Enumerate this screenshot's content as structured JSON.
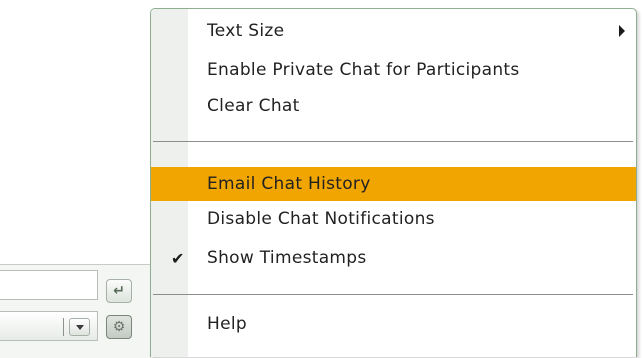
{
  "menu": {
    "items": [
      {
        "label": "Text Size",
        "has_submenu": true,
        "checked": false,
        "highlighted": false
      },
      {
        "label": "Enable Private Chat for Participants",
        "has_submenu": false,
        "checked": false,
        "highlighted": false
      },
      {
        "label": "Clear Chat",
        "has_submenu": false,
        "checked": false,
        "highlighted": false
      },
      {
        "label": "Email Chat History",
        "has_submenu": false,
        "checked": false,
        "highlighted": true
      },
      {
        "label": "Disable Chat Notifications",
        "has_submenu": false,
        "checked": false,
        "highlighted": false
      },
      {
        "label": "Show Timestamps",
        "has_submenu": false,
        "checked": true,
        "highlighted": false
      },
      {
        "label": "Help",
        "has_submenu": false,
        "checked": false,
        "highlighted": false
      }
    ],
    "check_glyph": "✔",
    "highlight_color": "#f0a500"
  },
  "chat_panel": {
    "send_icon": "enter-icon",
    "send_glyph": "↵",
    "options_icon": "gear-icon",
    "options_glyph": "⚙"
  }
}
